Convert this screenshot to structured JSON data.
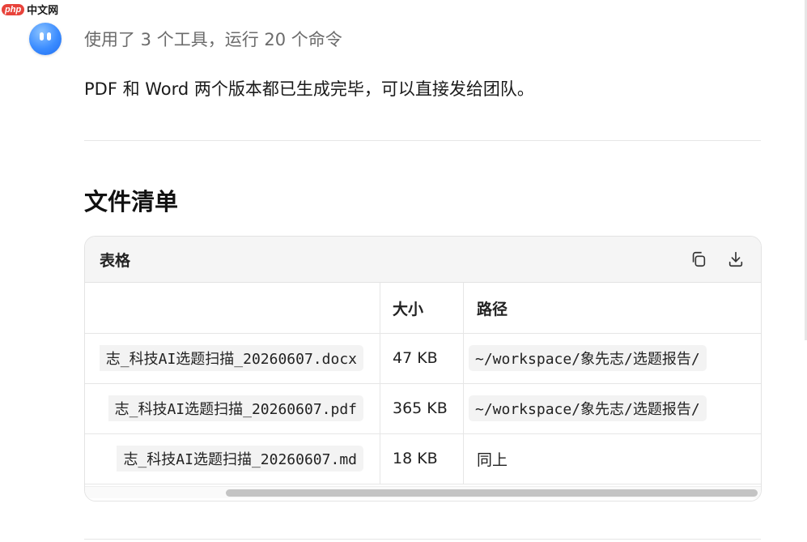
{
  "watermark": {
    "badge": "php",
    "text": "中文网"
  },
  "tools_summary": "使用了 3 个工具，运行 20 个命令",
  "message": "PDF 和 Word 两个版本都已生成完毕，可以直接发给团队。",
  "section_heading": "文件清单",
  "table": {
    "title": "表格",
    "copy_icon": "copy-icon",
    "download_icon": "download-icon",
    "columns": [
      "",
      "大小",
      "路径"
    ],
    "rows": [
      {
        "name": "志_科技AI选题扫描_20260607.docx",
        "size": "47 KB",
        "path": "~/workspace/象先志/选题报告/",
        "path_is_code": true
      },
      {
        "name": "志_科技AI选题扫描_20260607.pdf",
        "size": "365 KB",
        "path": "~/workspace/象先志/选题报告/",
        "path_is_code": true
      },
      {
        "name": "志_科技AI选题扫描_20260607.md",
        "size": "18 KB",
        "path": "同上",
        "path_is_code": false
      }
    ]
  },
  "colors": {
    "accent": "#3b8cff",
    "watermark": "#e8433b"
  }
}
